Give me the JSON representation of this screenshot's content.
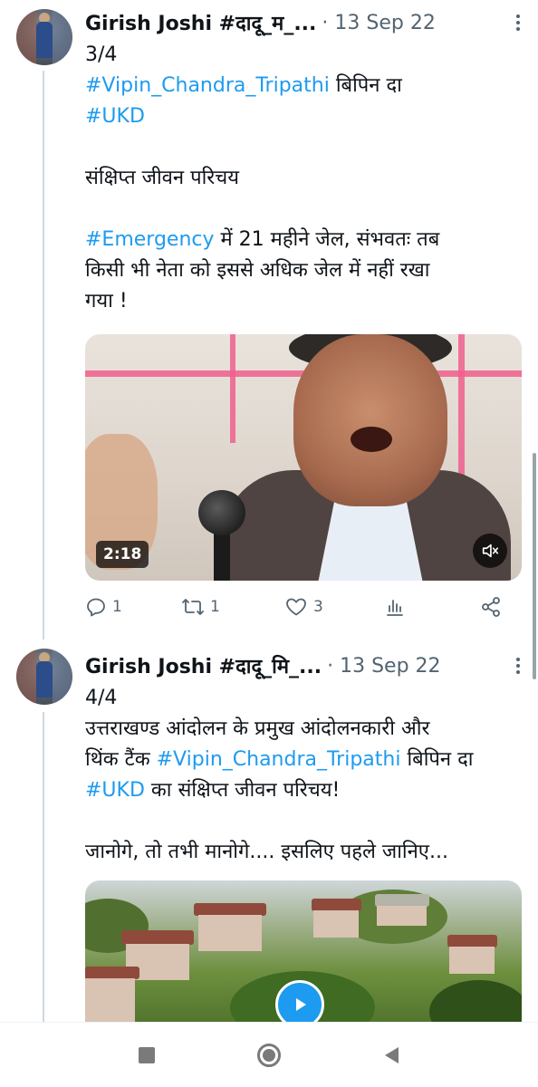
{
  "tweets": [
    {
      "author": "Girish Joshi #दादू_म_...",
      "meta": "· 13 Sep 22",
      "lines": [
        [
          {
            "text": "3/4"
          }
        ],
        [
          {
            "text": "#Vipin_Chandra_Tripathi",
            "hashtag": true
          },
          {
            "text": " बिपिन दा"
          }
        ],
        [
          {
            "text": " "
          },
          {
            "text": "#UKD",
            "hashtag": true
          }
        ],
        [
          {
            "text": ""
          }
        ],
        [
          {
            "text": "संक्षिप्त जीवन परिचय"
          }
        ],
        [
          {
            "text": ""
          }
        ],
        [
          {
            "text": "#Emergency",
            "hashtag": true
          },
          {
            "text": " में 21 महीने जेल, संभवतः तब"
          }
        ],
        [
          {
            "text": "किसी भी नेता को इससे अधिक जेल में नहीं रखा"
          }
        ],
        [
          {
            "text": "गया !"
          }
        ]
      ],
      "video_duration": "2:18",
      "actions": {
        "replies": "1",
        "retweets": "1",
        "likes": "3"
      }
    },
    {
      "author": "Girish Joshi #दादू_मि_...",
      "meta": "· 13 Sep 22",
      "lines": [
        [
          {
            "text": "4/4"
          }
        ],
        [
          {
            "text": "उत्तराखण्ड आंदोलन के प्रमुख आंदोलनकारी और"
          }
        ],
        [
          {
            "text": "थिंक टैंक "
          },
          {
            "text": "#Vipin_Chandra_Tripathi",
            "hashtag": true
          },
          {
            "text": " बिपिन दा"
          }
        ],
        [
          {
            "text": " "
          },
          {
            "text": "#UKD",
            "hashtag": true
          },
          {
            "text": " का संक्षिप्त जीवन परिचय!"
          }
        ],
        [
          {
            "text": ""
          }
        ],
        [
          {
            "text": "जानोगे, तो तभी मानोगे.... इसलिए पहले जानिए..."
          }
        ]
      ]
    }
  ],
  "icons": {
    "reply": "reply-icon",
    "retweet": "retweet-icon",
    "like": "heart-icon",
    "views": "views-icon",
    "share": "share-icon",
    "mute": "mute-icon",
    "play": "play-icon",
    "more": "more-icon",
    "nav_recents": "recents-icon",
    "nav_home": "home-icon",
    "nav_back": "back-icon"
  },
  "colors": {
    "hashtag": "#1d9bf0",
    "secondary_text": "#536471",
    "thread_line": "#cfd9de"
  }
}
